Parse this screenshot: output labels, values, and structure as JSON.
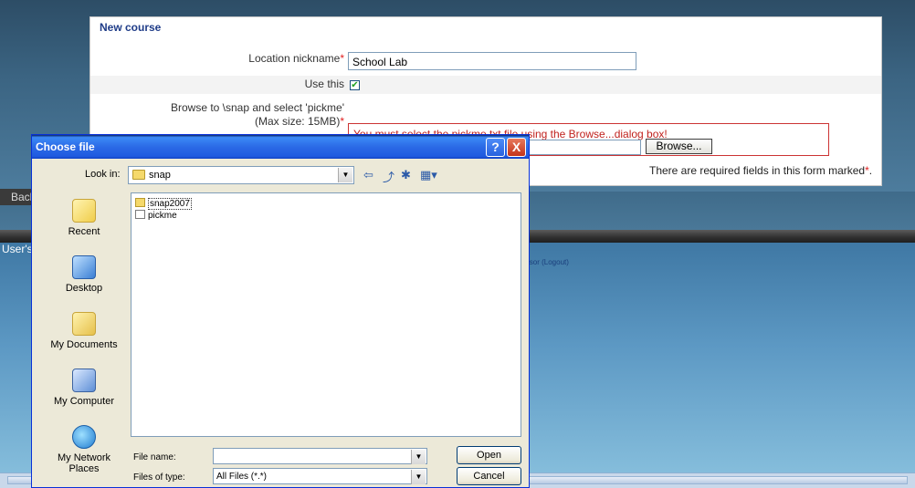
{
  "form": {
    "section_title": "New course",
    "location_label": "Location nickname",
    "location_value": "School Lab",
    "use_this_label": "Use this",
    "use_this_checked": true,
    "browse_label_line1": "Browse to \\snap and select 'pickme'",
    "browse_label_line2": "(Max size: 15MB)",
    "error_message": "You must select the pickme.txt file using the Browse...dialog box!",
    "browse_button": "Browse...",
    "required_note": "There are required fields in this form marked",
    "required_star": "*",
    "required_note_end": "."
  },
  "background": {
    "back_tab": "Back",
    "users_label": "User's",
    "logout_fragment": "isor (Logout)"
  },
  "dialog": {
    "title": "Choose file",
    "help_button": "?",
    "close_button": "X",
    "look_in_label": "Look in:",
    "look_in_value": "snap",
    "places": [
      {
        "label": "Recent",
        "icon": "recent-folder-icon"
      },
      {
        "label": "Desktop",
        "icon": "desktop-icon"
      },
      {
        "label": "My Documents",
        "icon": "my-documents-icon"
      },
      {
        "label": "My Computer",
        "icon": "my-computer-icon"
      },
      {
        "label": "My Network Places",
        "icon": "network-places-icon"
      }
    ],
    "files": [
      {
        "name": "snap2007",
        "type": "folder"
      },
      {
        "name": "pickme",
        "type": "file"
      }
    ],
    "file_name_label": "File name:",
    "file_name_value": "",
    "file_type_label": "Files of type:",
    "file_type_value": "All Files (*.*)",
    "open_button": "Open",
    "cancel_button": "Cancel"
  },
  "colors": {
    "error_red": "#c0221e",
    "title_blue": "#1f3c88",
    "xp_title": "#2b6ae6"
  }
}
